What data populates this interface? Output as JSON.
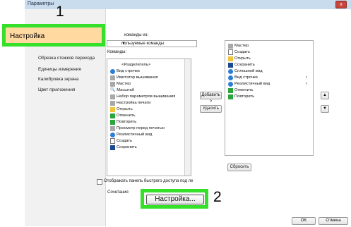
{
  "window": {
    "title": "Параметры",
    "close_label": "x"
  },
  "callouts": {
    "one": "1",
    "two": "2"
  },
  "sidebar": {
    "selected_label": "Настройка",
    "items": [
      {
        "label": "Обрезка стежков перехода"
      },
      {
        "label": "Единицы измерения"
      },
      {
        "label": "Калибровка экрана"
      },
      {
        "label": "Цвет приложения"
      }
    ]
  },
  "commands": {
    "from_label": "команды из:",
    "source_value": "пользуемые команды",
    "list_label": "Команды:",
    "items": [
      {
        "label": "<Разделитель>",
        "icon": "none",
        "has_submenu": false
      },
      {
        "label": "Вид строчки",
        "icon": "blue-circle-icon",
        "has_submenu": true
      },
      {
        "label": "Имитатор вышивания",
        "icon": "simulator-icon",
        "has_submenu": false
      },
      {
        "label": "Мастер",
        "icon": "wizard-icon",
        "has_submenu": false
      },
      {
        "label": "Масштаб",
        "icon": "magnifier-icon",
        "has_submenu": true
      },
      {
        "label": "Набор параметров вышивания",
        "icon": "parameter-set-icon",
        "has_submenu": false
      },
      {
        "label": "Настройка печати",
        "icon": "print-setup-icon",
        "has_submenu": false
      },
      {
        "label": "Открыть",
        "icon": "folder-icon",
        "has_submenu": false
      },
      {
        "label": "Отменить",
        "icon": "undo-icon",
        "has_submenu": false
      },
      {
        "label": "Повторить",
        "icon": "redo-icon",
        "has_submenu": false
      },
      {
        "label": "Просмотр перед печатью",
        "icon": "print-preview-icon",
        "has_submenu": false
      },
      {
        "label": "Реалистичный вид",
        "icon": "blue-circle-icon",
        "has_submenu": true
      },
      {
        "label": "Создать",
        "icon": "document-icon",
        "has_submenu": false
      },
      {
        "label": "Сохранить",
        "icon": "save-icon",
        "has_submenu": false
      }
    ]
  },
  "quick_access": {
    "items": [
      {
        "label": "Мастер",
        "icon": "wizard-icon",
        "has_submenu": false
      },
      {
        "label": "Создать",
        "icon": "document-icon",
        "has_submenu": false
      },
      {
        "label": "Открыть",
        "icon": "folder-icon",
        "has_submenu": false
      },
      {
        "label": "Сохранить",
        "icon": "save-icon",
        "has_submenu": false
      },
      {
        "label": "Сплошной вид",
        "icon": "blue-circle-icon",
        "has_submenu": false
      },
      {
        "label": "Вид строчки",
        "icon": "blue-circle-icon",
        "has_submenu": true
      },
      {
        "label": "Реалистичный вид",
        "icon": "blue-circle-icon",
        "has_submenu": true
      },
      {
        "label": "Отменить",
        "icon": "undo-icon",
        "has_submenu": false
      },
      {
        "label": "Повторить",
        "icon": "redo-icon",
        "has_submenu": false
      }
    ]
  },
  "buttons": {
    "add": "Добавить >",
    "remove": "Удалить",
    "reset": "Сбросить",
    "move_up": "▲",
    "move_down": "▼",
    "customize": "Настройка...",
    "ok": "OK",
    "cancel": "Отмена"
  },
  "options": {
    "show_qat_below": "Отображать панель быстрого доступа под ле",
    "shortcuts_label": "Сочетания"
  },
  "colors": {
    "highlight": "#34e02a",
    "selected_bg": "#ffd9a0",
    "title_bar": "#c9dced"
  }
}
